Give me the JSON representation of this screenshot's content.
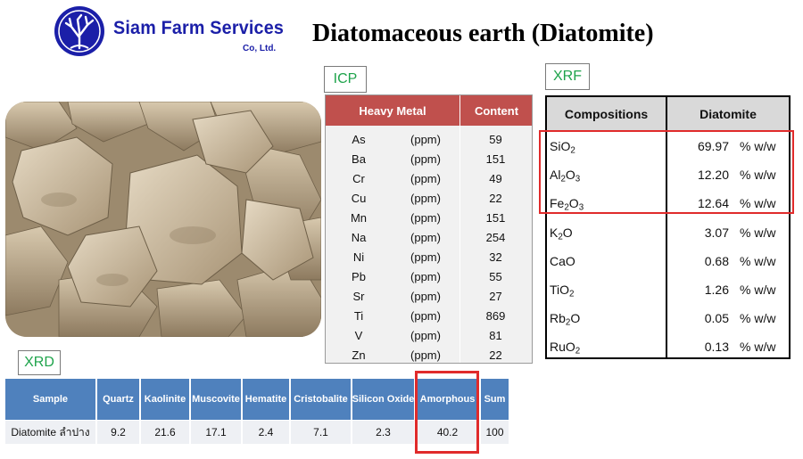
{
  "brand": {
    "name": "Siam Farm Services",
    "suffix": "Co, Ltd.",
    "colors": {
      "brand_blue": "#1b1fa8"
    }
  },
  "title": "Diatomaceous earth (Diatomite)",
  "icp": {
    "tag": "ICP",
    "headers": {
      "metal": "Heavy Metal",
      "content": "Content"
    },
    "rows": [
      {
        "element": "As",
        "unit": "(ppm)",
        "value": "59"
      },
      {
        "element": "Ba",
        "unit": "(ppm)",
        "value": "151"
      },
      {
        "element": "Cr",
        "unit": "(ppm)",
        "value": "49"
      },
      {
        "element": "Cu",
        "unit": "(ppm)",
        "value": "22"
      },
      {
        "element": "Mn",
        "unit": "(ppm)",
        "value": "151"
      },
      {
        "element": "Na",
        "unit": "(ppm)",
        "value": "254"
      },
      {
        "element": "Ni",
        "unit": "(ppm)",
        "value": "32"
      },
      {
        "element": "Pb",
        "unit": "(ppm)",
        "value": "55"
      },
      {
        "element": "Sr",
        "unit": "(ppm)",
        "value": "27"
      },
      {
        "element": "Ti",
        "unit": "(ppm)",
        "value": "869"
      },
      {
        "element": "V",
        "unit": "(ppm)",
        "value": "81"
      },
      {
        "element": "Zn",
        "unit": "(ppm)",
        "value": "22"
      }
    ],
    "colors": {
      "header_bg": "#c0504d",
      "body_bg": "#f1f1f1"
    }
  },
  "xrf": {
    "tag": "XRF",
    "headers": {
      "compositions": "Compositions",
      "diatomite": "Diatomite"
    },
    "rows": [
      {
        "compound": "SiO2",
        "base": "SiO",
        "sub": "2",
        "value": "69.97",
        "unit": "% w/w",
        "highlighted": true
      },
      {
        "compound": "Al2O3",
        "base": "Al",
        "sub": "2",
        "tail": "O",
        "sub2": "3",
        "value": "12.20",
        "unit": "% w/w",
        "highlighted": true
      },
      {
        "compound": "Fe2O3",
        "base": "Fe",
        "sub": "2",
        "tail": "O",
        "sub2": "3",
        "value": "12.64",
        "unit": "% w/w",
        "highlighted": true
      },
      {
        "compound": "K2O",
        "base": "K",
        "sub": "2",
        "tail": "O",
        "value": "3.07",
        "unit": "% w/w",
        "highlighted": false
      },
      {
        "compound": "CaO",
        "base": "CaO",
        "value": "0.68",
        "unit": "% w/w",
        "highlighted": false
      },
      {
        "compound": "TiO2",
        "base": "TiO",
        "sub": "2",
        "value": "1.26",
        "unit": "% w/w",
        "highlighted": false
      },
      {
        "compound": "Rb2O",
        "base": "Rb",
        "sub": "2",
        "tail": "O",
        "value": "0.05",
        "unit": "% w/w",
        "highlighted": false
      },
      {
        "compound": "RuO2",
        "base": "RuO",
        "sub": "2",
        "value": "0.13",
        "unit": "% w/w",
        "highlighted": false
      }
    ],
    "colors": {
      "header_bg": "#d9d9d9",
      "highlight": "#e02b2b"
    }
  },
  "xrd": {
    "tag": "XRD",
    "headers": [
      "Sample",
      "Quartz",
      "Kaolinite",
      "Muscovite",
      "Hematite",
      "Cristobalite",
      "Silicon Oxide",
      "Amorphous",
      "Sum"
    ],
    "row": [
      "Diatomite ลำปาง",
      "9.2",
      "21.6",
      "17.1",
      "2.4",
      "7.1",
      "2.3",
      "40.2",
      "100"
    ],
    "highlighted_column": "Amorphous",
    "colors": {
      "header_bg": "#4f81bd",
      "cell_bg": "#eef0f4",
      "highlight": "#e02b2b"
    }
  },
  "tag_text_color": "#1ea34b"
}
